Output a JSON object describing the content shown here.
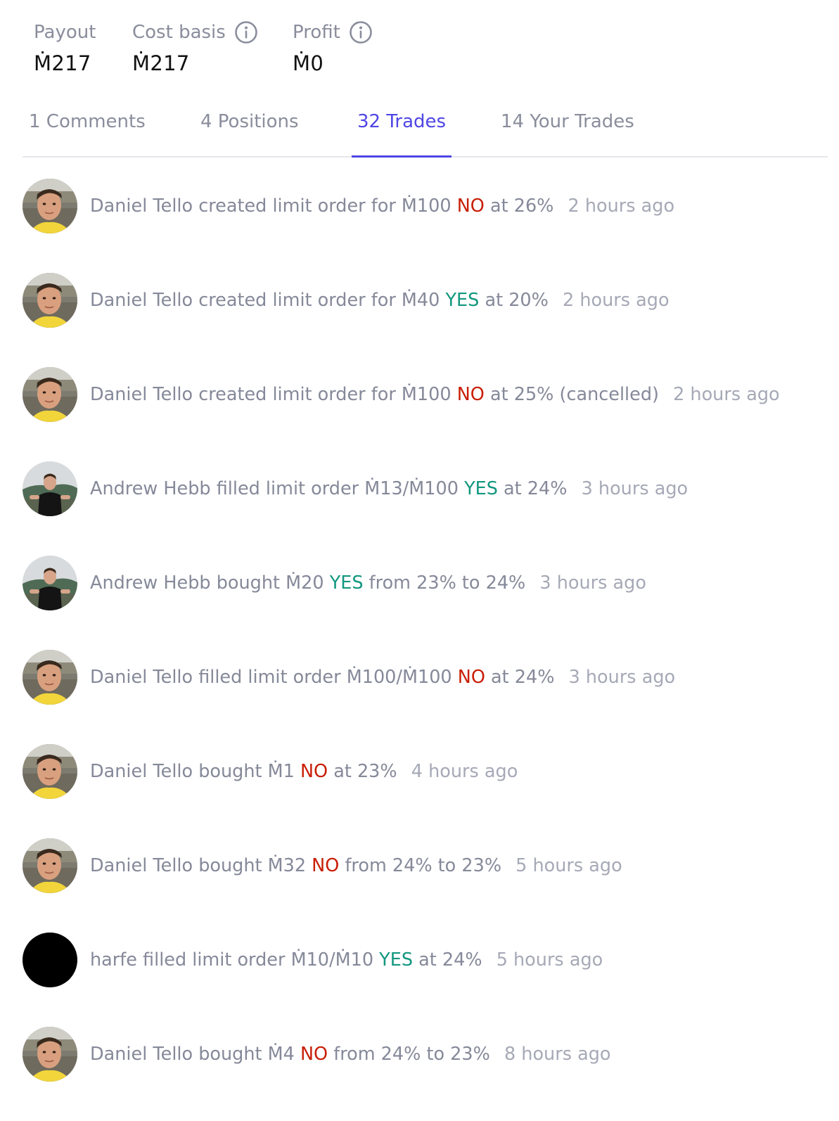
{
  "stats": {
    "payout": {
      "label": "Payout",
      "value": "Ṁ217"
    },
    "cost_basis": {
      "label": "Cost basis",
      "value": "Ṁ217"
    },
    "profit": {
      "label": "Profit",
      "value": "Ṁ0"
    }
  },
  "tabs": [
    {
      "label": "1 Comments",
      "active": false
    },
    {
      "label": "4 Positions",
      "active": false
    },
    {
      "label": "32 Trades",
      "active": true
    },
    {
      "label": "14 Your Trades",
      "active": false
    }
  ],
  "colors": {
    "accent": "#4f46e5",
    "yes": "#12977f",
    "no": "#c81e06",
    "muted_text": "#858999",
    "time_text": "#a6a9b6"
  },
  "feed": [
    {
      "avatar": "daniel-tello-avatar",
      "name": "Daniel Tello",
      "action": "created limit order for",
      "amount": "Ṁ100",
      "outcome": "NO",
      "detail": "at 26%",
      "time": "2 hours ago"
    },
    {
      "avatar": "daniel-tello-avatar",
      "name": "Daniel Tello",
      "action": "created limit order for",
      "amount": "Ṁ40",
      "outcome": "YES",
      "detail": "at 20%",
      "time": "2 hours ago"
    },
    {
      "avatar": "daniel-tello-avatar",
      "name": "Daniel Tello",
      "action": "created limit order for",
      "amount": "Ṁ100",
      "outcome": "NO",
      "detail": "at 25% (cancelled)",
      "time": "2 hours ago"
    },
    {
      "avatar": "andrew-hebb-avatar",
      "name": "Andrew Hebb",
      "action": "filled limit order",
      "amount": "Ṁ13/Ṁ100",
      "outcome": "YES",
      "detail": "at 24%",
      "time": "3 hours ago"
    },
    {
      "avatar": "andrew-hebb-avatar",
      "name": "Andrew Hebb",
      "action": "bought",
      "amount": "Ṁ20",
      "outcome": "YES",
      "detail": "from 23% to 24%",
      "time": "3 hours ago"
    },
    {
      "avatar": "daniel-tello-avatar",
      "name": "Daniel Tello",
      "action": "filled limit order",
      "amount": "Ṁ100/Ṁ100",
      "outcome": "NO",
      "detail": "at 24%",
      "time": "3 hours ago"
    },
    {
      "avatar": "daniel-tello-avatar",
      "name": "Daniel Tello",
      "action": "bought",
      "amount": "Ṁ1",
      "outcome": "NO",
      "detail": "at 23%",
      "time": "4 hours ago"
    },
    {
      "avatar": "daniel-tello-avatar",
      "name": "Daniel Tello",
      "action": "bought",
      "amount": "Ṁ32",
      "outcome": "NO",
      "detail": "from 24% to 23%",
      "time": "5 hours ago"
    },
    {
      "avatar": "harfe-avatar",
      "name": "harfe",
      "action": "filled limit order",
      "amount": "Ṁ10/Ṁ10",
      "outcome": "YES",
      "detail": "at 24%",
      "time": "5 hours ago"
    },
    {
      "avatar": "daniel-tello-avatar",
      "name": "Daniel Tello",
      "action": "bought",
      "amount": "Ṁ4",
      "outcome": "NO",
      "detail": "from 24% to 23%",
      "time": "8 hours ago"
    }
  ]
}
